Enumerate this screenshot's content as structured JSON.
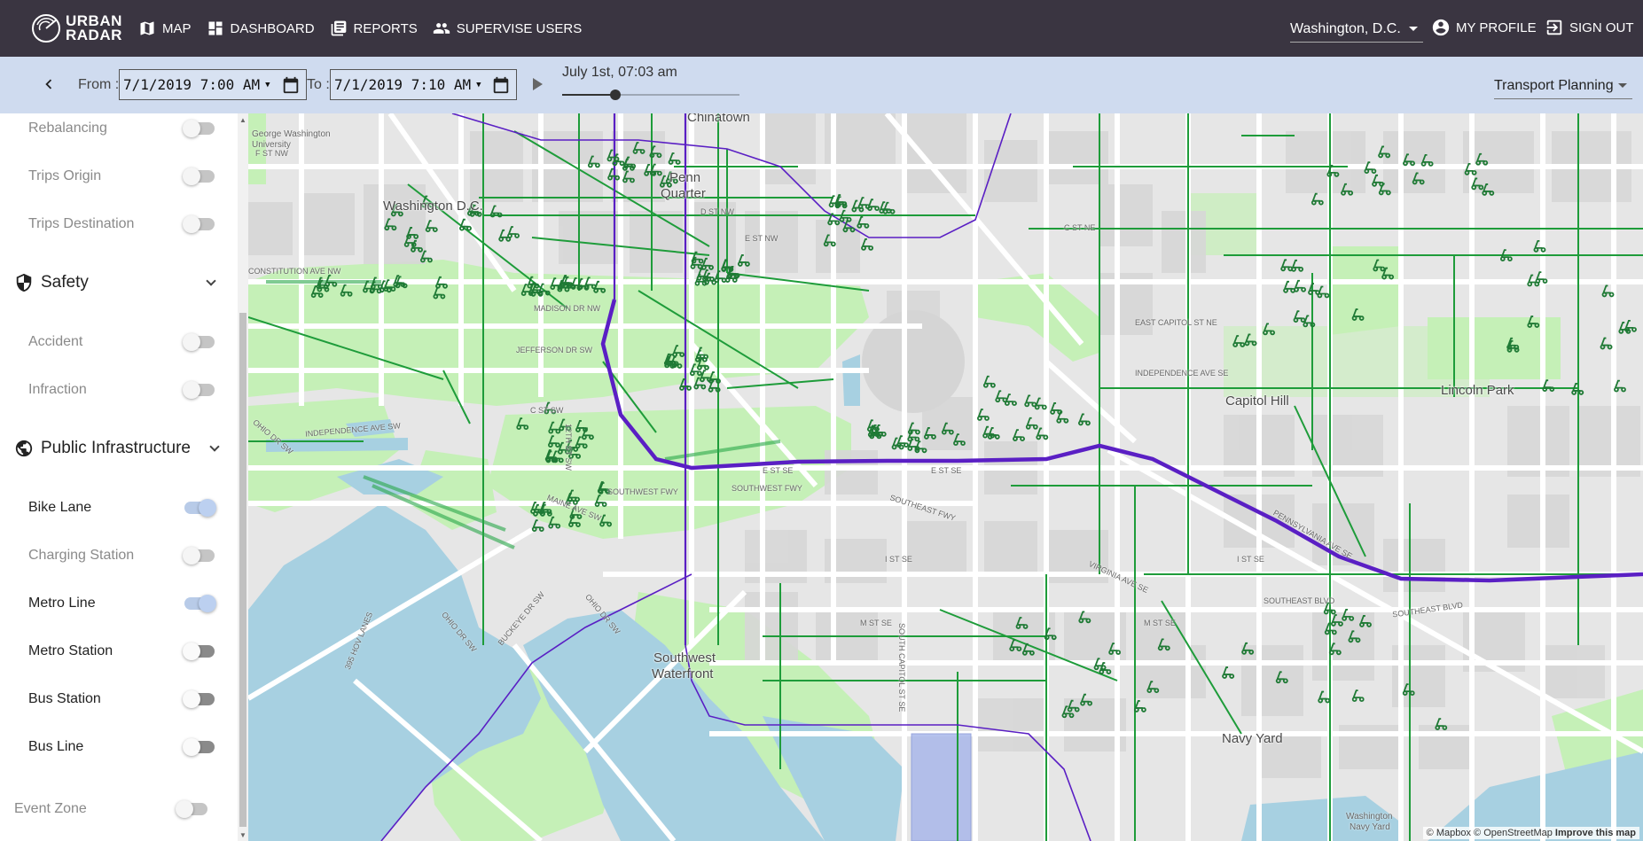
{
  "brand": {
    "logo_text_1": "URBAN",
    "logo_text_2": "RADAR"
  },
  "nav": {
    "map": "MAP",
    "dashboard": "DASHBOARD",
    "reports": "REPORTS",
    "supervise_users": "SUPERVISE USERS"
  },
  "header": {
    "city": "Washington, D.C.",
    "profile": "MY PROFILE",
    "sign_out": "SIGN OUT"
  },
  "toolbar": {
    "from_label": "From :",
    "from_value": "7/1/2019 7:00  AM",
    "to_label": "To :",
    "to_value": "7/1/2019 7:10  AM",
    "current_time": "July 1st, 07:03 am",
    "slider_progress": 0.3,
    "plan": "Transport Planning"
  },
  "sidebar": {
    "top_layers": [
      {
        "label": "Rebalancing",
        "state": "off"
      },
      {
        "label": "Trips Origin",
        "state": "off"
      },
      {
        "label": "Trips Destination",
        "state": "off"
      }
    ],
    "safety": {
      "title": "Safety",
      "layers": [
        {
          "label": "Accident",
          "state": "off"
        },
        {
          "label": "Infraction",
          "state": "off"
        }
      ]
    },
    "public_infrastructure": {
      "title": "Public Infrastructure",
      "layers": [
        {
          "label": "Bike Lane",
          "state": "on"
        },
        {
          "label": "Charging Station",
          "state": "off"
        },
        {
          "label": "Metro Line",
          "state": "on"
        },
        {
          "label": "Metro Station",
          "state": "dark"
        },
        {
          "label": "Bus Station",
          "state": "dark"
        },
        {
          "label": "Bus Line",
          "state": "dark"
        }
      ]
    },
    "event_zone": {
      "label": "Event Zone",
      "state": "off"
    }
  },
  "map": {
    "labels": {
      "washington": "Washington D.C.",
      "penn_quarter_1": "Penn",
      "penn_quarter_2": "Quarter",
      "chinatown": "Chinatown",
      "capitol_hill": "Capitol Hill",
      "lincoln_park": "Lincoln Park",
      "sw_waterfront_1": "Southwest",
      "sw_waterfront_2": "Waterfront",
      "navy_yard": "Navy Yard",
      "gw_univ_1": "George Washington",
      "gw_univ_2": "University",
      "navy_yard_station_1": "Washington",
      "navy_yard_station_2": "Navy Yard"
    },
    "streets": {
      "independence": "INDEPENDENCE AVE SW",
      "madison": "MADISON DR NW",
      "jefferson": "JEFFERSON DR SW",
      "c_st_sw": "C ST SW",
      "sw_fwy": "SOUTHWEST FWY",
      "se_fwy": "SOUTHEAST FWY",
      "maine": "MAINE AVE SW",
      "e_st_se": "E ST SE",
      "i_st_se": "I ST SE",
      "m_st_se": "M ST SE",
      "pennsylvania": "PENNSYLVANIA AVE SE",
      "virginia": "VIRGINIA AVE SE",
      "se_blvd": "SOUTHEAST BLVD",
      "ohio": "OHIO DR SW",
      "buckeye": "BUCKEYE DR SW",
      "e_capitol": "EAST CAPITOL ST NE",
      "independence_se": "INDEPENDENCE AVE SE",
      "c_st_ne": "C ST NE",
      "d_st_nw": "D ST NW",
      "e_st_nw": "E ST NW",
      "constitution": "CONSTITUTION AVE NW",
      "f_st_nw": "F ST NW",
      "twelfth": "12TH ST SW",
      "south_capitol": "SOUTH CAPITOL ST SE",
      "lanes": "395 HOV LANES"
    },
    "attribution": {
      "mapbox": "© Mapbox",
      "osm": "© OpenStreetMap",
      "improve": "Improve this map"
    }
  },
  "colors": {
    "topbar": "#3a3541",
    "toolbar": "#cfdbef",
    "bike_lane": "#1e9c3a",
    "metro_line": "#5a1fc4",
    "water": "#a5cfe0",
    "park": "#c3f2b6",
    "event_zone": "#a9b8ea"
  }
}
